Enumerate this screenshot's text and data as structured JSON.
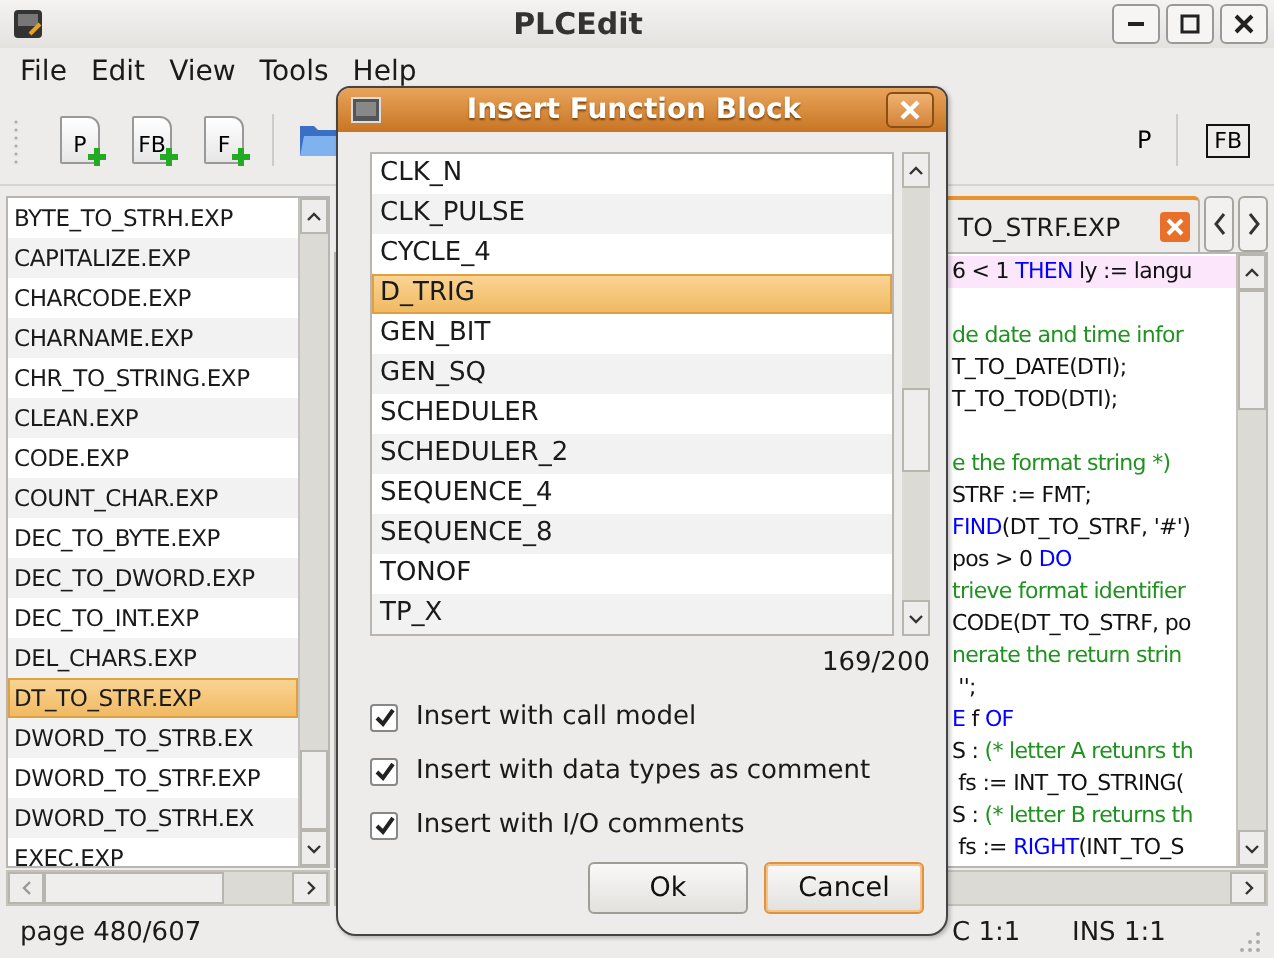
{
  "window": {
    "title": "PLCEdit"
  },
  "menu": [
    "File",
    "Edit",
    "View",
    "Tools",
    "Help"
  ],
  "toolbar": [
    {
      "kind": "new",
      "label": "P"
    },
    {
      "kind": "new",
      "label": "FB"
    },
    {
      "kind": "new",
      "label": "F"
    },
    {
      "kind": "open"
    },
    {
      "kind": "partial",
      "label": "P"
    },
    {
      "kind": "boxed",
      "label": "FB"
    }
  ],
  "files": [
    {
      "name": "BYTE_TO_STRH.EXP",
      "selected": false
    },
    {
      "name": "CAPITALIZE.EXP",
      "selected": false
    },
    {
      "name": "CHARCODE.EXP",
      "selected": false
    },
    {
      "name": "CHARNAME.EXP",
      "selected": false
    },
    {
      "name": "CHR_TO_STRING.EXP",
      "selected": false
    },
    {
      "name": "CLEAN.EXP",
      "selected": false
    },
    {
      "name": "CODE.EXP",
      "selected": false
    },
    {
      "name": "COUNT_CHAR.EXP",
      "selected": false
    },
    {
      "name": "DEC_TO_BYTE.EXP",
      "selected": false
    },
    {
      "name": "DEC_TO_DWORD.EXP",
      "selected": false
    },
    {
      "name": "DEC_TO_INT.EXP",
      "selected": false
    },
    {
      "name": "DEL_CHARS.EXP",
      "selected": false
    },
    {
      "name": "DT_TO_STRF.EXP",
      "selected": true
    },
    {
      "name": "DWORD_TO_STRB.EX",
      "selected": false
    },
    {
      "name": "DWORD_TO_STRF.EXP",
      "selected": false
    },
    {
      "name": "DWORD_TO_STRH.EX",
      "selected": false
    },
    {
      "name": "EXEC.EXP",
      "selected": false
    }
  ],
  "editor": {
    "tab": "TO_STRF.EXP",
    "lines": [
      {
        "current": true,
        "segments": [
          {
            "kind": "plain",
            "text": "6 < 1 "
          },
          {
            "kind": "keyword",
            "text": "THEN"
          },
          {
            "kind": "plain",
            "text": " ly := langu"
          }
        ]
      },
      {
        "current": false
      },
      {
        "current": false,
        "segments": [
          {
            "kind": "comment",
            "text": "de date and time infor"
          }
        ]
      },
      {
        "current": false,
        "segments": [
          {
            "kind": "plain",
            "text": "T_TO_DATE(DTI);"
          }
        ]
      },
      {
        "current": false,
        "segments": [
          {
            "kind": "plain",
            "text": "T_TO_TOD(DTI);"
          }
        ]
      },
      {
        "current": false
      },
      {
        "current": false,
        "segments": [
          {
            "kind": "comment",
            "text": "e the format string *)"
          }
        ]
      },
      {
        "current": false,
        "segments": [
          {
            "kind": "plain",
            "text": "STRF := FMT;"
          }
        ]
      },
      {
        "current": false,
        "segments": [
          {
            "kind": "keyword",
            "text": "FIND"
          },
          {
            "kind": "plain",
            "text": "(DT_TO_STRF, '#')"
          }
        ]
      },
      {
        "current": false,
        "segments": [
          {
            "kind": "plain",
            "text": "pos > 0 "
          },
          {
            "kind": "keyword",
            "text": "DO"
          }
        ]
      },
      {
        "current": false,
        "segments": [
          {
            "kind": "comment",
            "text": "trieve format identifier"
          }
        ]
      },
      {
        "current": false,
        "segments": [
          {
            "kind": "plain",
            "text": "CODE(DT_TO_STRF, po"
          }
        ]
      },
      {
        "current": false,
        "segments": [
          {
            "kind": "comment",
            "text": "nerate the return strin"
          }
        ]
      },
      {
        "current": false,
        "segments": [
          {
            "kind": "plain",
            "text": " '';"
          }
        ]
      },
      {
        "current": false,
        "segments": [
          {
            "kind": "keyword",
            "text": "E"
          },
          {
            "kind": "plain",
            "text": " f "
          },
          {
            "kind": "keyword",
            "text": "OF"
          }
        ]
      },
      {
        "current": false,
        "segments": [
          {
            "kind": "plain",
            "text": "S : "
          },
          {
            "kind": "comment",
            "text": "(* letter A retunrs th"
          }
        ]
      },
      {
        "current": false,
        "segments": [
          {
            "kind": "plain",
            "text": " fs := INT_TO_STRING("
          }
        ]
      },
      {
        "current": false,
        "segments": [
          {
            "kind": "plain",
            "text": "S : "
          },
          {
            "kind": "comment",
            "text": "(* letter B returns th"
          }
        ]
      },
      {
        "current": false,
        "segments": [
          {
            "kind": "plain",
            "text": " fs := "
          },
          {
            "kind": "keyword",
            "text": "RIGHT"
          },
          {
            "kind": "plain",
            "text": "(INT_TO_S"
          }
        ]
      }
    ]
  },
  "status_bar": {
    "page": "page 480/607",
    "position": "C 1:1",
    "mode": "INS 1:1"
  },
  "dialog": {
    "title": "Insert Function Block",
    "items": [
      {
        "name": "CLK_N",
        "selected": false
      },
      {
        "name": "CLK_PULSE",
        "selected": false
      },
      {
        "name": "CYCLE_4",
        "selected": false
      },
      {
        "name": "D_TRIG",
        "selected": true
      },
      {
        "name": "GEN_BIT",
        "selected": false
      },
      {
        "name": "GEN_SQ",
        "selected": false
      },
      {
        "name": "SCHEDULER",
        "selected": false
      },
      {
        "name": "SCHEDULER_2",
        "selected": false
      },
      {
        "name": "SEQUENCE_4",
        "selected": false
      },
      {
        "name": "SEQUENCE_8",
        "selected": false
      },
      {
        "name": "TONOF",
        "selected": false
      },
      {
        "name": "TP_X",
        "selected": false
      }
    ],
    "counter": "169/200",
    "options": [
      {
        "label": "Insert with call model",
        "checked": true
      },
      {
        "label": "Insert with data types as comment",
        "checked": true
      },
      {
        "label": "Insert with I/O comments",
        "checked": true
      }
    ],
    "buttons": [
      {
        "label": "Ok",
        "focused": false
      },
      {
        "label": "Cancel",
        "focused": true
      }
    ]
  }
}
